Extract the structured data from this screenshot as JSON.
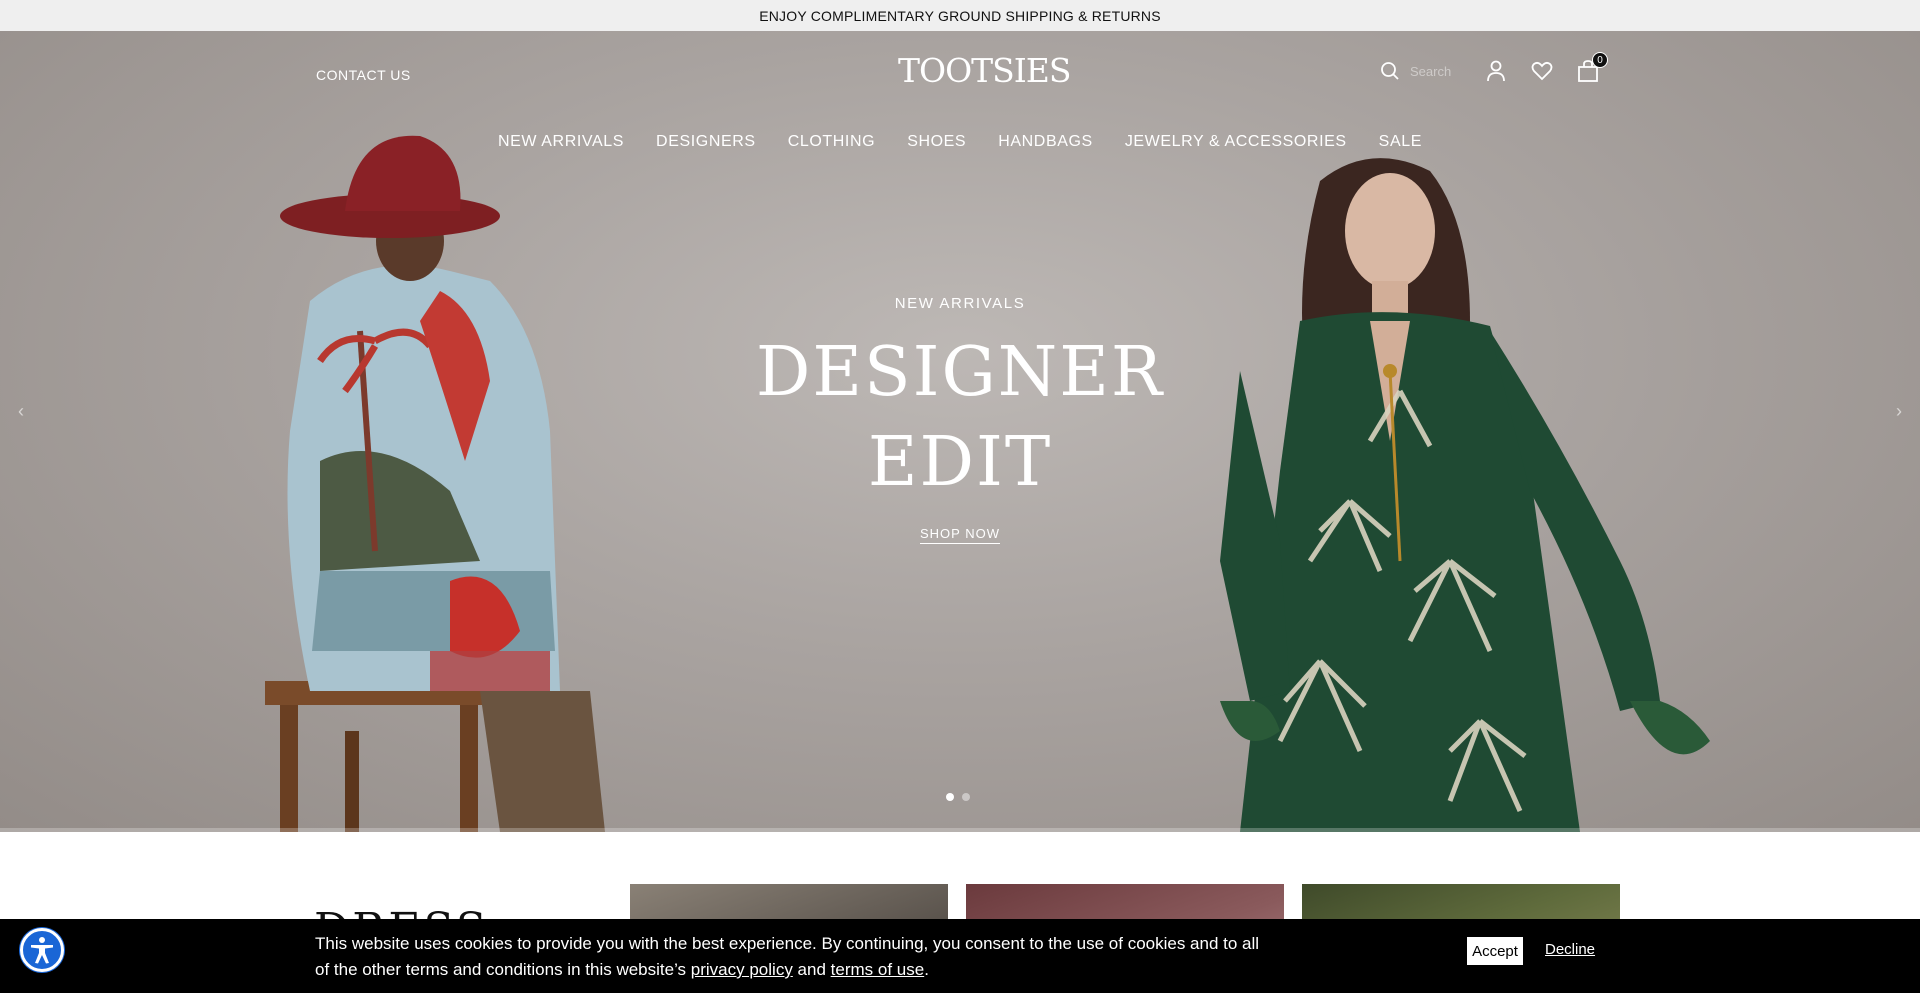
{
  "promo": {
    "text": "ENJOY COMPLIMENTARY GROUND SHIPPING & RETURNS"
  },
  "header": {
    "contact_label": "CONTACT US",
    "logo_text": "TOOTSIES",
    "search_placeholder": "Search",
    "cart_count": "0",
    "icons": [
      "search-icon",
      "user-icon",
      "heart-icon",
      "bag-icon"
    ]
  },
  "nav": {
    "items": [
      {
        "label": "NEW ARRIVALS"
      },
      {
        "label": "DESIGNERS"
      },
      {
        "label": "CLOTHING"
      },
      {
        "label": "SHOES"
      },
      {
        "label": "HANDBAGS"
      },
      {
        "label": "JEWELRY & ACCESSORIES"
      },
      {
        "label": "SALE"
      }
    ]
  },
  "hero": {
    "eyebrow": "NEW ARRIVALS",
    "headline_line1": "DESIGNER",
    "headline_line2": "EDIT",
    "cta": "SHOP NOW",
    "prev_arrow": "‹",
    "next_arrow": "›",
    "slides_total": 2,
    "active_slide": 1
  },
  "below": {
    "section_title": "DRESS"
  },
  "cookie": {
    "text_part1": "This website uses cookies to provide you with the best experience. By continuing, you consent to the use of cookies and to all of the other terms and conditions in this website’s ",
    "privacy_link": "privacy policy",
    "text_and": " and ",
    "terms_link": "terms of use",
    "text_end": ".",
    "accept_label": "Accept",
    "decline_label": "Decline"
  },
  "colors": {
    "accessibility_button": "#1a66d6",
    "cookie_bar": "#000000",
    "promo_bar": "#efefef"
  }
}
